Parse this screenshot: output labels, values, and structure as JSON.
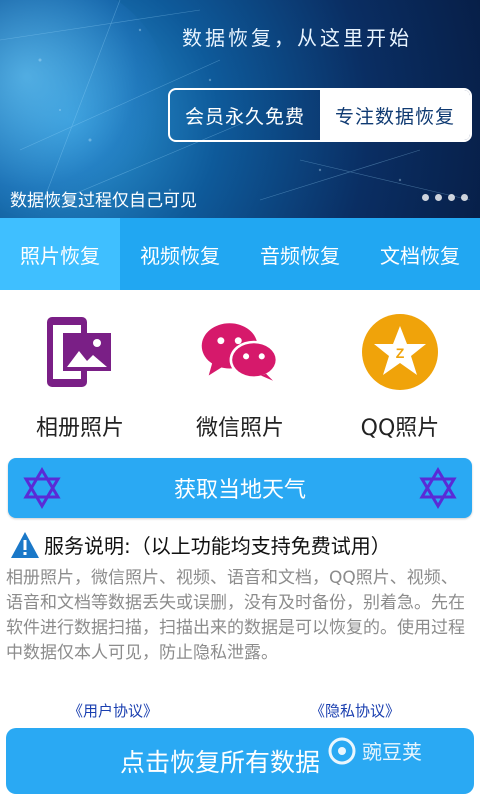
{
  "banner": {
    "title": "数据恢复，从这里开始",
    "pill_left": "会员永久免费",
    "pill_right": "专注数据恢复",
    "caption": "数据恢复过程仅自己可见"
  },
  "tabs": [
    {
      "label": "照片恢复",
      "active": true
    },
    {
      "label": "视频恢复"
    },
    {
      "label": "音频恢复"
    },
    {
      "label": "文档恢复"
    }
  ],
  "features": [
    {
      "label": "相册照片",
      "icon": "album-photo-icon",
      "color": "#7a1f86"
    },
    {
      "label": "微信照片",
      "icon": "wechat-icon",
      "color": "#d6196b"
    },
    {
      "label": "QQ照片",
      "icon": "qq-icon",
      "color": "#f0a30a"
    }
  ],
  "weather": {
    "label": "获取当地天气",
    "icon": "star-of-david-icon"
  },
  "notice": {
    "title": "服务说明:（以上功能均支持免费试用）",
    "description": "相册照片，微信照片、视频、语音和文档，QQ照片、视频、语音和文档等数据丢失或误删，没有及时备份，别着急。先在软件进行数据扫描，扫描出来的数据是可以恢复的。使用过程中数据仅本人可见，防止隐私泄露。"
  },
  "links": {
    "user_agreement": "《用户协议》",
    "privacy": "《隐私协议》"
  },
  "recover_button": {
    "label": "点击恢复所有数据"
  },
  "watermark": {
    "label": "豌豆荚"
  },
  "colors": {
    "primary": "#21a7f2",
    "active_tab": "#3fbfff",
    "link": "#1a3fb0"
  }
}
